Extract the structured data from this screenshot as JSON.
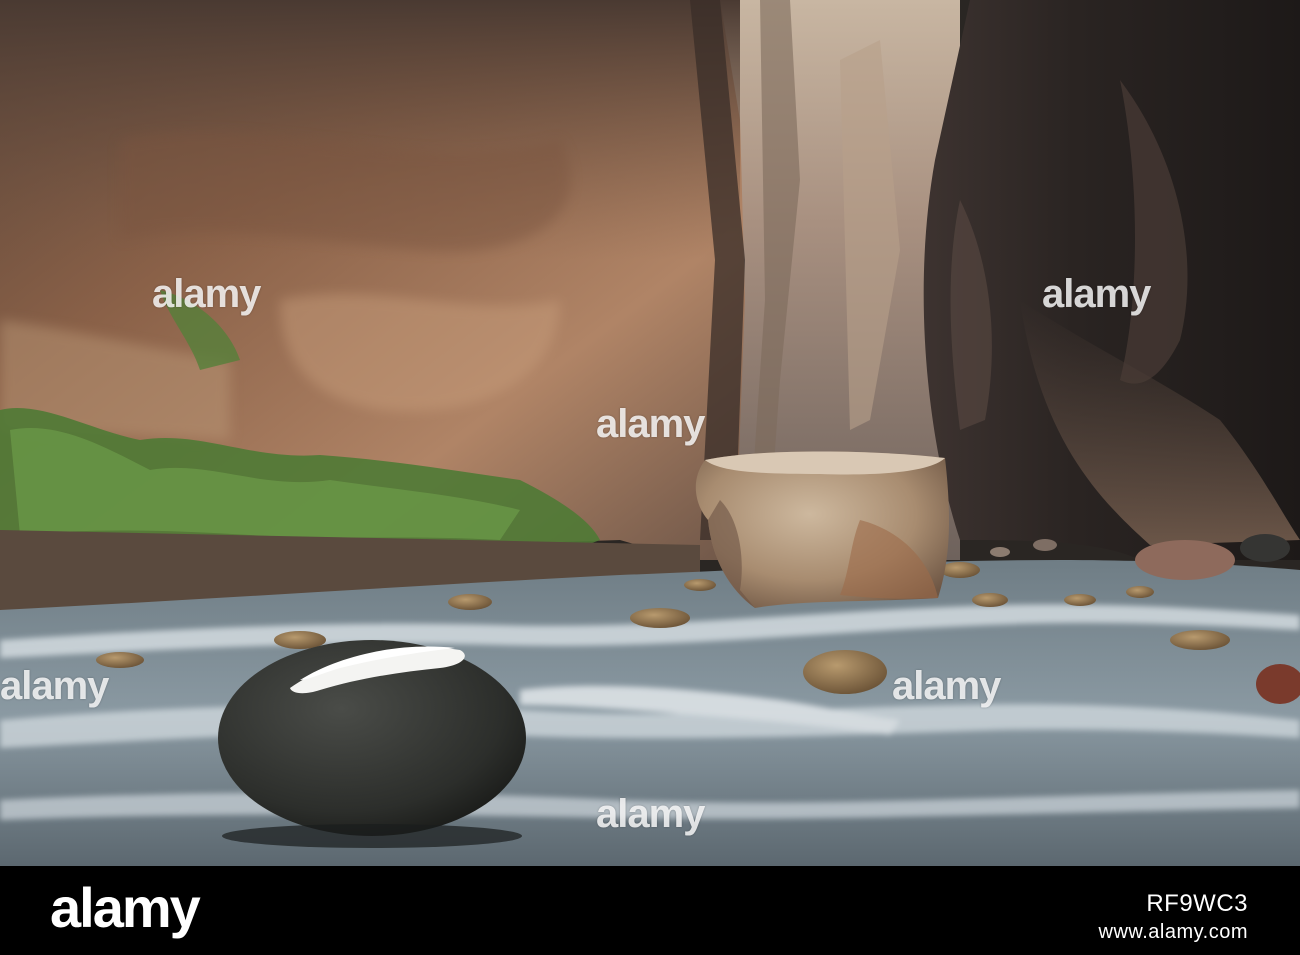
{
  "photo": {
    "description_colors": {
      "left_wall": "#a6785a",
      "right_wall": "#2b2523",
      "back_wall": "#9a8778",
      "water": "#8d9aa3",
      "foliage": "#4f7a35",
      "boulder_light": "#b49c82",
      "boulder_dark": "#2e302d"
    }
  },
  "watermarks": [
    "alamy",
    "alamy",
    "alamy",
    "alamy",
    "alamy",
    "alamy"
  ],
  "footer": {
    "brand": "alamy",
    "image_id": "RF9WC3",
    "site": "www.alamy.com"
  }
}
